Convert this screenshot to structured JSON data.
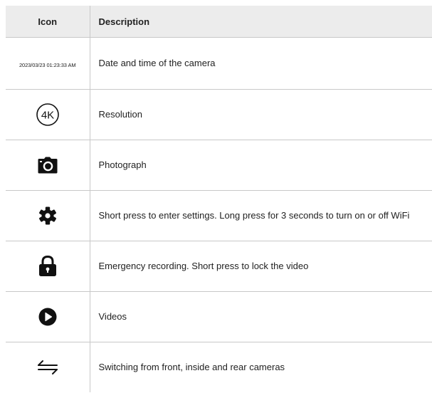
{
  "table": {
    "headers": {
      "icon": "Icon",
      "description": "Description"
    },
    "rows": [
      {
        "icon": "datetime-text",
        "icon_text": "2023/03/23  01:23:33 AM",
        "description": "Date and time of the camera"
      },
      {
        "icon": "4k-resolution-icon",
        "icon_text": "4K",
        "description": "Resolution"
      },
      {
        "icon": "camera-icon",
        "description": "Photograph"
      },
      {
        "icon": "gear-icon",
        "description": "Short press to enter settings. Long press for 3 seconds to turn on or off WiFi"
      },
      {
        "icon": "lock-icon",
        "description": "Emergency recording. Short press to lock the video"
      },
      {
        "icon": "play-icon",
        "description": "Videos"
      },
      {
        "icon": "switch-arrows-icon",
        "description": "Switching from front, inside and rear cameras"
      }
    ]
  }
}
